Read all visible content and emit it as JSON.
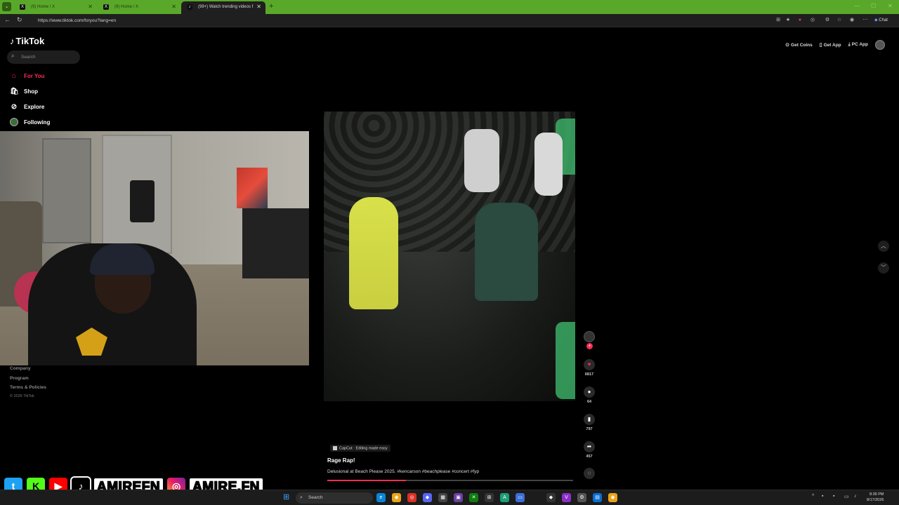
{
  "browser": {
    "tabs": [
      {
        "label": "(9) Home / X",
        "favicon": "X"
      },
      {
        "label": "(9) Home / X",
        "favicon": "X"
      },
      {
        "label": "(99+) Watch trending videos f",
        "favicon": "♪"
      }
    ],
    "url": "https://www.tiktok.com/foryou?lang=en",
    "chat_label": "Chat"
  },
  "tiktok": {
    "logo": "TikTok",
    "search_placeholder": "Search",
    "nav": [
      {
        "label": "For You",
        "icon": "home-icon"
      },
      {
        "label": "Shop",
        "icon": "shop-icon"
      },
      {
        "label": "Explore",
        "icon": "explore-icon"
      },
      {
        "label": "Following",
        "icon": "following-avatar"
      }
    ],
    "footer": [
      "Company",
      "Program",
      "Terms & Policies"
    ],
    "copyright": "© 2026 TikTok",
    "top_actions": {
      "coins": "Get Coins",
      "app": "Get App",
      "pc_app": "PC App"
    },
    "video": {
      "capcut": "CapCut · Editing made easy",
      "title": "Rage Rap!",
      "description": "Delusional at Beach Please 2025. #kencarson #beachplease #concert #fyp",
      "progress_percent": 32,
      "likes": "6817",
      "comments": "64",
      "saves": "797",
      "shares": "457"
    }
  },
  "overlay": {
    "handle_main": "AMIREFN",
    "handle_ig": "AMIRE.FN"
  },
  "taskbar": {
    "search_label": "Search",
    "time": "8:36 PM",
    "date": "8/17/2026"
  },
  "colors": {
    "accent": "#fe2c55",
    "tabbar": "#5aa82a"
  }
}
